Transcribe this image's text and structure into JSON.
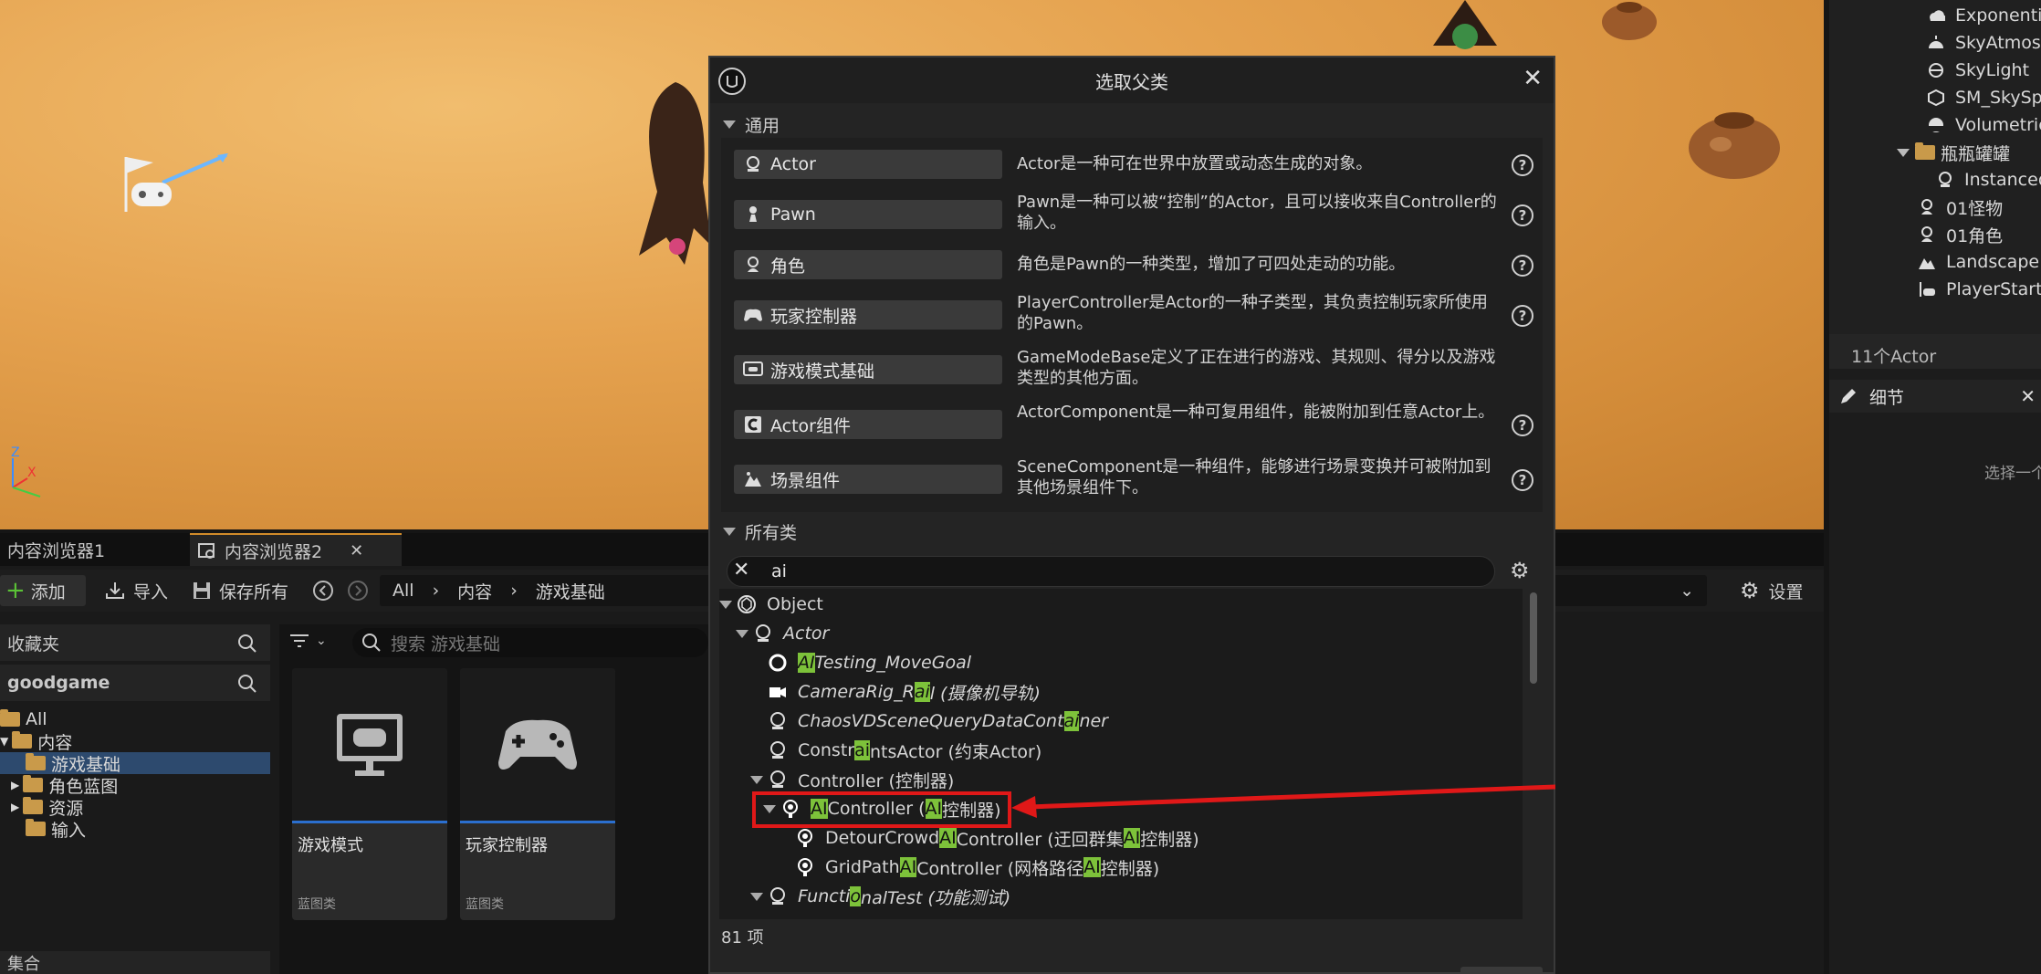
{
  "dialog": {
    "title": "选取父类",
    "common_header": "通用",
    "all_header": "所有类",
    "search_value": "ai",
    "item_count": "81 项",
    "help_glyph": "?",
    "common": [
      {
        "label": "Actor",
        "desc": "Actor是一种可在世界中放置或动态生成的对象。"
      },
      {
        "label": "Pawn",
        "desc": "Pawn是一种可以被“控制”的Actor，且可以接收来自Controller的输入。"
      },
      {
        "label": "角色",
        "desc": "角色是Pawn的一种类型，增加了可四处走动的功能。"
      },
      {
        "label": "玩家控制器",
        "desc": "PlayerController是Actor的一种子类型，其负责控制玩家所使用的Pawn。"
      },
      {
        "label": "游戏模式基础",
        "desc": "GameModeBase定义了正在进行的游戏、其规则、得分以及游戏类型的其他方面。"
      },
      {
        "label": "Actor组件",
        "desc": "ActorComponent是一种可复用组件，能被附加到任意Actor上。"
      },
      {
        "label": "场景组件",
        "desc": "SceneComponent是一种组件，能够进行场景变换并可被附加到其他场景组件下。"
      }
    ],
    "tree": {
      "object": "Object",
      "actor": "Actor",
      "ai_testing": [
        "AI",
        "Testing_MoveGoal"
      ],
      "camera_rig": [
        "CameraRig_R",
        "ai",
        "l (摄像机导轨)"
      ],
      "chaos": [
        "ChaosVDSceneQueryDataCont",
        "ai",
        "ner"
      ],
      "constraints": [
        "Constr",
        "ai",
        "ntsActor (约束Actor)"
      ],
      "controller": "Controller (控制器)",
      "ai_controller": [
        "AI",
        "Controller (",
        "AI",
        "控制器)"
      ],
      "detour": [
        "DetourCrowd",
        "AI",
        "Controller (迂回群集",
        "AI",
        "控制器)"
      ],
      "gridpath": [
        "GridPath",
        "AI",
        "Controller (网格路径",
        "AI",
        "控制器)"
      ],
      "functional": [
        "Functi",
        "o",
        "nalTest (功能测试)"
      ]
    }
  },
  "outliner": {
    "items": [
      "Exponential",
      "SkyAtmos",
      "SkyLight",
      "SM_SkySp",
      "Volumetric",
      "瓶瓶罐罐",
      "InstancedF",
      "01怪物",
      "01角色",
      "Landscape",
      "PlayerStart"
    ],
    "count": "11个Actor",
    "details_title": "细节",
    "details_hint": "选择一个"
  },
  "content_browser": {
    "tab1": "内容浏览器1",
    "tab2": "内容浏览器2",
    "add": "添加",
    "import": "导入",
    "save_all": "保存所有",
    "breadcrumb": [
      "All",
      "内容",
      "游戏基础"
    ],
    "settings": "设置",
    "favorites": "收藏夹",
    "project": "goodgame",
    "search_placeholder": "搜索 游戏基础",
    "tree": [
      "All",
      "内容",
      "游戏基础",
      "角色蓝图",
      "资源",
      "输入"
    ],
    "assets": [
      {
        "name": "游戏模式",
        "type": "蓝图类"
      },
      {
        "name": "玩家控制器",
        "type": "蓝图类"
      }
    ],
    "collections": "集合"
  },
  "colors": {
    "highlight": "#7dc23a",
    "annotation": "#e01818",
    "selection": "#2b6fcf"
  }
}
